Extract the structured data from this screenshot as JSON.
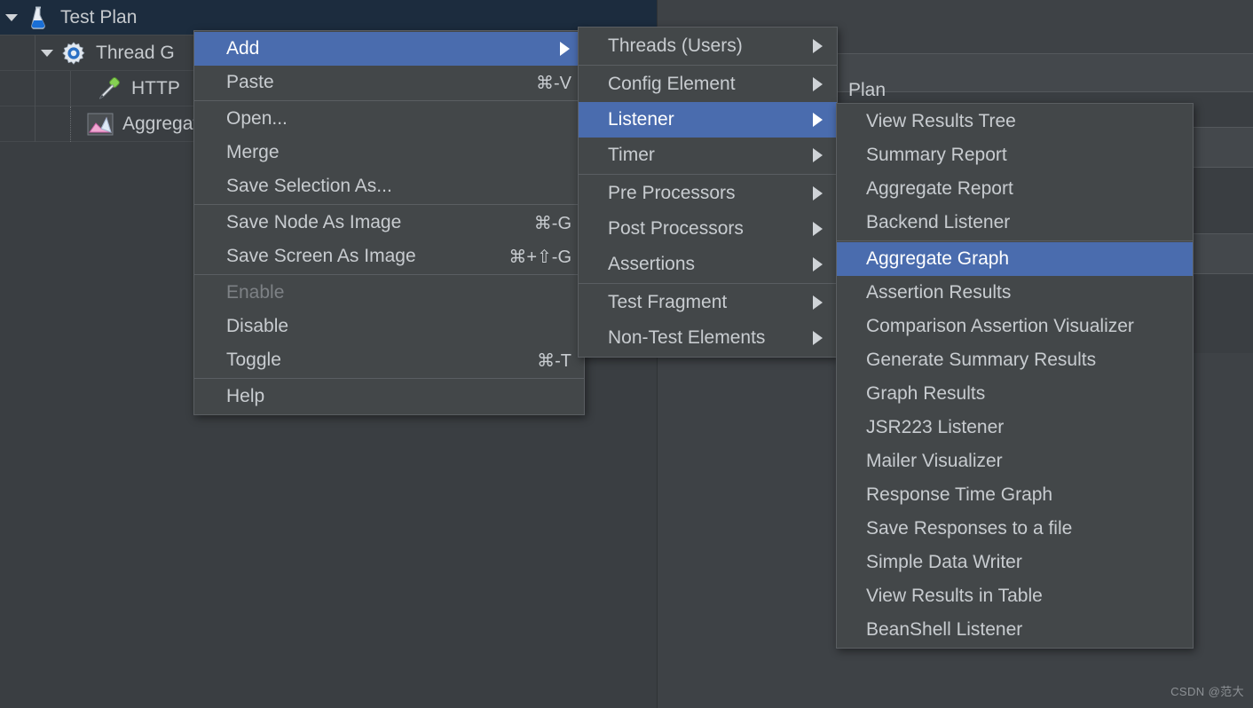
{
  "app": {
    "background_color": "#3a3e42",
    "menu_background_color": "#434749",
    "highlight_color": "#4a6cae",
    "text_color": "#c8ccd0"
  },
  "tree": {
    "rows": [
      {
        "label": "Test Plan",
        "icon": "flask-icon",
        "depth": 0,
        "expanded": true,
        "selected": true
      },
      {
        "label": "Thread G",
        "icon": "gear-icon",
        "depth": 1,
        "expanded": true,
        "selected": false
      },
      {
        "label": "HTTP",
        "icon": "pipette-icon",
        "depth": 2,
        "expanded": false,
        "selected": false
      },
      {
        "label": "Aggregat",
        "icon": "aggregate-chart-icon",
        "depth": 2,
        "expanded": false,
        "selected": false
      }
    ]
  },
  "background_panel": {
    "label": "Plan"
  },
  "context_menu": {
    "title": "node-context-menu",
    "items": [
      {
        "label": "Add",
        "accel": "",
        "submenu": true,
        "highlighted": true,
        "disabled": false,
        "separator_after": false
      },
      {
        "label": "Paste",
        "accel": "⌘-V",
        "submenu": false,
        "highlighted": false,
        "disabled": false,
        "separator_after": true
      },
      {
        "label": "Open...",
        "accel": "",
        "submenu": false,
        "highlighted": false,
        "disabled": false,
        "separator_after": false
      },
      {
        "label": "Merge",
        "accel": "",
        "submenu": false,
        "highlighted": false,
        "disabled": false,
        "separator_after": false
      },
      {
        "label": "Save Selection As...",
        "accel": "",
        "submenu": false,
        "highlighted": false,
        "disabled": false,
        "separator_after": true
      },
      {
        "label": "Save Node As Image",
        "accel": "⌘-G",
        "submenu": false,
        "highlighted": false,
        "disabled": false,
        "separator_after": false
      },
      {
        "label": "Save Screen As Image",
        "accel": "⌘+⇧-G",
        "submenu": false,
        "highlighted": false,
        "disabled": false,
        "separator_after": true
      },
      {
        "label": "Enable",
        "accel": "",
        "submenu": false,
        "highlighted": false,
        "disabled": true,
        "separator_after": false
      },
      {
        "label": "Disable",
        "accel": "",
        "submenu": false,
        "highlighted": false,
        "disabled": false,
        "separator_after": false
      },
      {
        "label": "Toggle",
        "accel": "⌘-T",
        "submenu": false,
        "highlighted": false,
        "disabled": false,
        "separator_after": true
      },
      {
        "label": "Help",
        "accel": "",
        "submenu": false,
        "highlighted": false,
        "disabled": false,
        "separator_after": false
      }
    ]
  },
  "add_submenu": {
    "title": "add-submenu",
    "items": [
      {
        "label": "Threads (Users)",
        "submenu": true,
        "highlighted": false,
        "separator_after": true
      },
      {
        "label": "Config Element",
        "submenu": true,
        "highlighted": false,
        "separator_after": false
      },
      {
        "label": "Listener",
        "submenu": true,
        "highlighted": true,
        "separator_after": false
      },
      {
        "label": "Timer",
        "submenu": true,
        "highlighted": false,
        "separator_after": true
      },
      {
        "label": "Pre Processors",
        "submenu": true,
        "highlighted": false,
        "separator_after": false
      },
      {
        "label": "Post Processors",
        "submenu": true,
        "highlighted": false,
        "separator_after": false
      },
      {
        "label": "Assertions",
        "submenu": true,
        "highlighted": false,
        "separator_after": true
      },
      {
        "label": "Test Fragment",
        "submenu": true,
        "highlighted": false,
        "separator_after": false
      },
      {
        "label": "Non-Test Elements",
        "submenu": true,
        "highlighted": false,
        "separator_after": false
      }
    ]
  },
  "listener_submenu": {
    "title": "listener-submenu",
    "items": [
      {
        "label": "View Results Tree",
        "highlighted": false,
        "separator_after": false
      },
      {
        "label": "Summary Report",
        "highlighted": false,
        "separator_after": false
      },
      {
        "label": "Aggregate Report",
        "highlighted": false,
        "separator_after": false
      },
      {
        "label": "Backend Listener",
        "highlighted": false,
        "separator_after": true
      },
      {
        "label": "Aggregate Graph",
        "highlighted": true,
        "separator_after": false
      },
      {
        "label": "Assertion Results",
        "highlighted": false,
        "separator_after": false
      },
      {
        "label": "Comparison Assertion Visualizer",
        "highlighted": false,
        "separator_after": false
      },
      {
        "label": "Generate Summary Results",
        "highlighted": false,
        "separator_after": false
      },
      {
        "label": "Graph Results",
        "highlighted": false,
        "separator_after": false
      },
      {
        "label": "JSR223 Listener",
        "highlighted": false,
        "separator_after": false
      },
      {
        "label": "Mailer Visualizer",
        "highlighted": false,
        "separator_after": false
      },
      {
        "label": "Response Time Graph",
        "highlighted": false,
        "separator_after": false
      },
      {
        "label": "Save Responses to a file",
        "highlighted": false,
        "separator_after": false
      },
      {
        "label": "Simple Data Writer",
        "highlighted": false,
        "separator_after": false
      },
      {
        "label": "View Results in Table",
        "highlighted": false,
        "separator_after": false
      },
      {
        "label": "BeanShell Listener",
        "highlighted": false,
        "separator_after": false
      }
    ]
  },
  "watermark": {
    "text": "CSDN @范大"
  }
}
